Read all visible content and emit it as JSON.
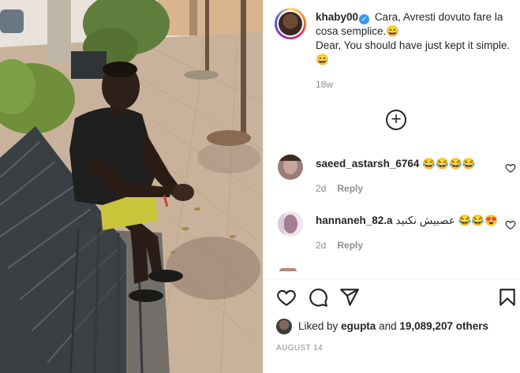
{
  "post": {
    "author": "khaby00",
    "caption_it": "Cara, Avresti dovuto fare la cosa semplice.😄",
    "caption_en": "Dear, You should have just kept it simple. 😄",
    "age": "18w",
    "date": "AUGUST 14"
  },
  "comments": [
    {
      "user": "saeed_astarsh_6764",
      "text": "😂😂😂😂",
      "age": "2d",
      "reply_label": "Reply"
    },
    {
      "user": "hannaneh_82.a",
      "text": "عصبیش نکنید 😂😂😍",
      "age": "2d",
      "reply_label": "Reply"
    }
  ],
  "likes": {
    "prefix": "Liked by",
    "user": "egupta",
    "joiner": "and",
    "count_text": "19,089,207 others"
  },
  "icons": {
    "load_more": "plus-circle-icon",
    "like": "heart-icon",
    "comment": "comment-icon",
    "share": "paper-plane-icon",
    "save": "bookmark-icon"
  }
}
